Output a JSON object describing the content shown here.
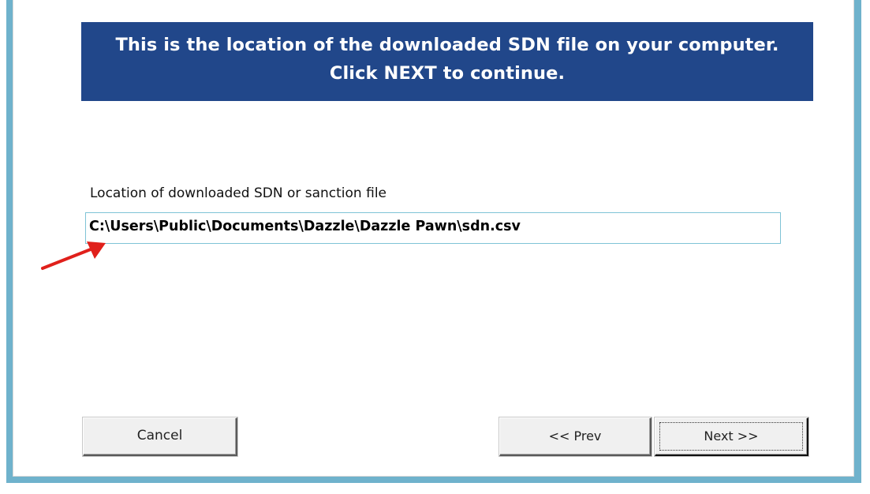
{
  "banner": {
    "line1": "This is the location of the downloaded SDN file on your computer.",
    "line2": "Click NEXT to continue."
  },
  "file_location": {
    "label": "Location of downloaded SDN or sanction file",
    "value": "C:\\Users\\Public\\Documents\\Dazzle\\Dazzle Pawn\\sdn.csv"
  },
  "buttons": {
    "cancel": "Cancel",
    "prev": "<< Prev",
    "next": "Next >>"
  },
  "colors": {
    "banner_background": "#21478a",
    "window_border": "#6fb2cc",
    "annotation_arrow": "#e0201b"
  },
  "icons": {
    "annotation": "red-arrow-icon"
  }
}
